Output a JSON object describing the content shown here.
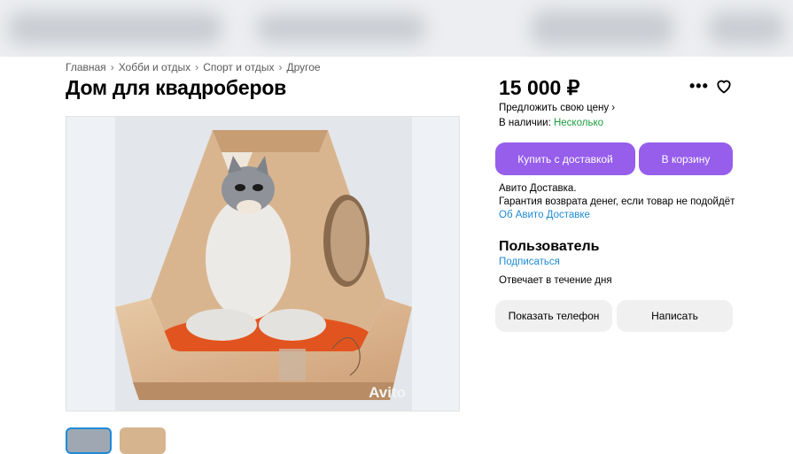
{
  "breadcrumb": [
    "Главная",
    "Хобби и отдых",
    "Спорт и отдых",
    "Другое"
  ],
  "listing": {
    "title": "Дом для квадроберов",
    "price": "15 000 ₽",
    "offer_price": "Предложить свою цену ›",
    "availability_label": "В наличии: ",
    "availability_value": "Несколько",
    "watermark": "Avito"
  },
  "actions": {
    "buy_delivery": "Купить с доставкой",
    "to_cart": "В корзину",
    "show_phone": "Показать телефон",
    "write": "Написать"
  },
  "delivery": {
    "line1": "Авито Доставка.",
    "line2": "Гарантия возврата денег, если товар не подойдёт",
    "link": "Об Авито Доставке"
  },
  "seller": {
    "name": "Пользователь",
    "subscribe": "Подписаться",
    "response": "Отвечает в течение дня"
  },
  "colors": {
    "accent": "#965eeb",
    "link": "#1f8bd6",
    "in_stock": "#1c9c3f"
  }
}
